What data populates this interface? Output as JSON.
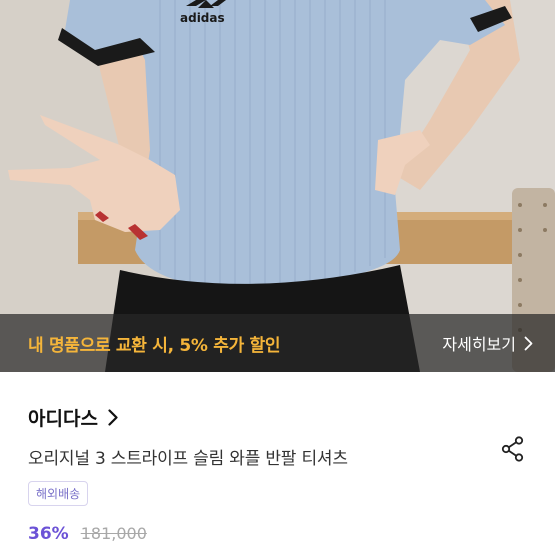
{
  "product": {
    "promo_text": "내 명품으로 교환 시, 5% 추가 할인",
    "promo_detail_label": "자세히보기",
    "brand": "아디다스",
    "title": "오리지널 3 스트라이프 슬림 와플 반팔 티셔츠",
    "badge": "해외배송",
    "discount": "36%",
    "original_price": "181,000",
    "shirt_logo_text": "adidas"
  },
  "colors": {
    "promo_text": "#f5b53a",
    "discount": "#6b52d6",
    "badge": "#7a71c9"
  },
  "icons": {
    "promo_chevron": "chevron-right-icon",
    "brand_chevron": "chevron-right-icon",
    "share": "share-icon"
  }
}
